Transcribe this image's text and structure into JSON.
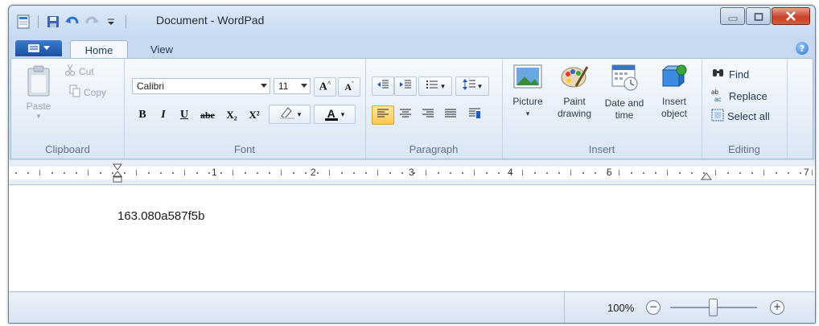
{
  "window": {
    "title": "Document - WordPad"
  },
  "tabs": {
    "home": "Home",
    "view": "View"
  },
  "clipboard": {
    "paste": "Paste",
    "cut": "Cut",
    "copy": "Copy",
    "label": "Clipboard"
  },
  "font": {
    "family": "Calibri",
    "size": "11",
    "label": "Font",
    "bold": "B",
    "italic": "I",
    "underline": "U",
    "strike": "abe",
    "subscript": "X₂",
    "superscript": "X²",
    "color_glyph": "A"
  },
  "paragraph": {
    "label": "Paragraph"
  },
  "insert": {
    "picture": "Picture",
    "paint_drawing": [
      "Paint",
      "drawing"
    ],
    "date_time": [
      "Date and",
      "time"
    ],
    "insert_object": [
      "Insert",
      "object"
    ],
    "label": "Insert"
  },
  "editing": {
    "find": "Find",
    "replace": "Replace",
    "select_all": "Select all",
    "label": "Editing"
  },
  "ruler": {
    "numbers": [
      "1",
      "2",
      "3",
      "4",
      "5",
      "7"
    ]
  },
  "document": {
    "text": "163.080a587f5b"
  },
  "status": {
    "zoom": "100%",
    "zoom_level_percent": 100
  },
  "colors": {
    "accent": "#1b4f9e",
    "ribbon_bg": "#e3ecf7",
    "close_button": "#c7432a"
  },
  "icons": [
    "app-icon",
    "save-icon",
    "undo-icon",
    "redo-icon",
    "customize-icon",
    "minimize-icon",
    "maximize-icon",
    "close-icon",
    "help-icon",
    "paste-icon",
    "cut-icon",
    "copy-icon",
    "grow-font-icon",
    "shrink-font-icon",
    "highlight-icon",
    "font-color-icon",
    "decrease-indent-icon",
    "increase-indent-icon",
    "bullets-icon",
    "line-spacing-icon",
    "align-left-icon",
    "align-center-icon",
    "align-right-icon",
    "justify-icon",
    "paragraph-icon",
    "picture-icon",
    "paint-icon",
    "date-time-icon",
    "insert-object-icon",
    "find-icon",
    "replace-icon",
    "select-all-icon",
    "zoom-out-icon",
    "zoom-in-icon"
  ]
}
